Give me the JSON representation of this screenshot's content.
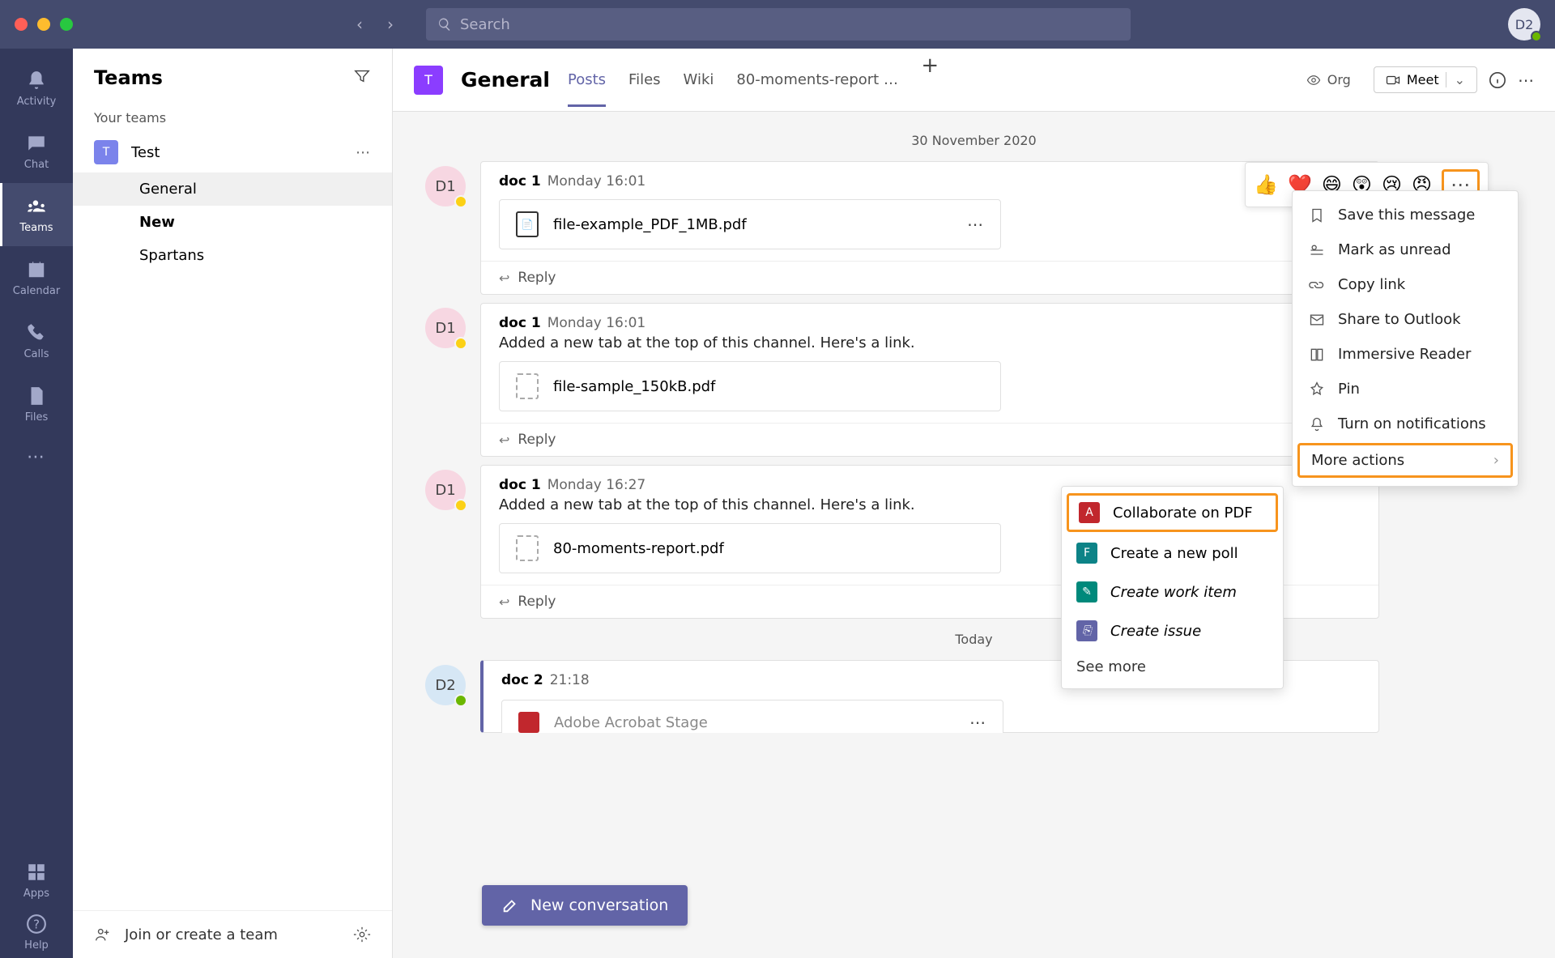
{
  "titlebar": {
    "search_placeholder": "Search",
    "avatar_initials": "D2"
  },
  "rail": {
    "items": [
      {
        "label": "Activity"
      },
      {
        "label": "Chat"
      },
      {
        "label": "Teams"
      },
      {
        "label": "Calendar"
      },
      {
        "label": "Calls"
      },
      {
        "label": "Files"
      }
    ],
    "apps": "Apps",
    "help": "Help"
  },
  "sidebar": {
    "title": "Teams",
    "section": "Your teams",
    "team": {
      "initial": "T",
      "name": "Test"
    },
    "channels": [
      {
        "name": "General"
      },
      {
        "name": "New"
      },
      {
        "name": "Spartans"
      }
    ],
    "footer": "Join or create a team"
  },
  "header": {
    "team_initial": "T",
    "channel_title": "General",
    "tabs": [
      "Posts",
      "Files",
      "Wiki",
      "80-moments-report 1...."
    ],
    "org": "Org",
    "meet": "Meet"
  },
  "feed": {
    "date1": "30 November 2020",
    "date2": "Today",
    "messages": [
      {
        "author": "doc 1",
        "initials": "D1",
        "time": "Monday 16:01",
        "text": "",
        "file": "file-example_PDF_1MB.pdf",
        "file_dashed": false
      },
      {
        "author": "doc 1",
        "initials": "D1",
        "time": "Monday 16:01",
        "text": "Added a new tab at the top of this channel. Here's a link.",
        "file": "file-sample_150kB.pdf",
        "file_dashed": true
      },
      {
        "author": "doc 1",
        "initials": "D1",
        "time": "Monday 16:27",
        "text": "Added a new tab at the top of this channel. Here's a link.",
        "file": "80-moments-report.pdf",
        "file_dashed": true
      },
      {
        "author": "doc 2",
        "initials": "D2",
        "time": "21:18",
        "text": "",
        "file": "Adobe Acrobat Stage",
        "file_dashed": false
      }
    ],
    "reply": "Reply",
    "new_conversation": "New conversation"
  },
  "reactions": [
    "👍",
    "❤️",
    "😄",
    "😲",
    "😢",
    "😠"
  ],
  "more_icon": "⋯",
  "context_menu": {
    "items": [
      "Save this message",
      "Mark as unread",
      "Copy link",
      "Share to Outlook",
      "Immersive Reader",
      "Pin",
      "Turn on notifications"
    ],
    "more_actions": "More actions"
  },
  "sub_menu": {
    "collaborate": "Collaborate on PDF",
    "poll": "Create a new poll",
    "work_item": "Create work item",
    "issue": "Create issue",
    "see_more": "See more"
  }
}
